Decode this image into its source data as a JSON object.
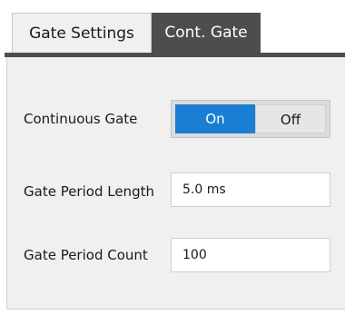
{
  "tabs": {
    "gate_settings": "Gate Settings",
    "cont_gate": "Cont. Gate"
  },
  "continuous_gate": {
    "label": "Continuous Gate",
    "on_label": "On",
    "off_label": "Off",
    "selected": "On"
  },
  "gate_period_length": {
    "label": "Gate Period Length",
    "value": "5.0 ms"
  },
  "gate_period_count": {
    "label": "Gate Period Count",
    "value": "100"
  },
  "colors": {
    "active_tab": "#4d4d4d",
    "accent": "#1a7fd4",
    "panel_bg": "#f0f0f0"
  }
}
